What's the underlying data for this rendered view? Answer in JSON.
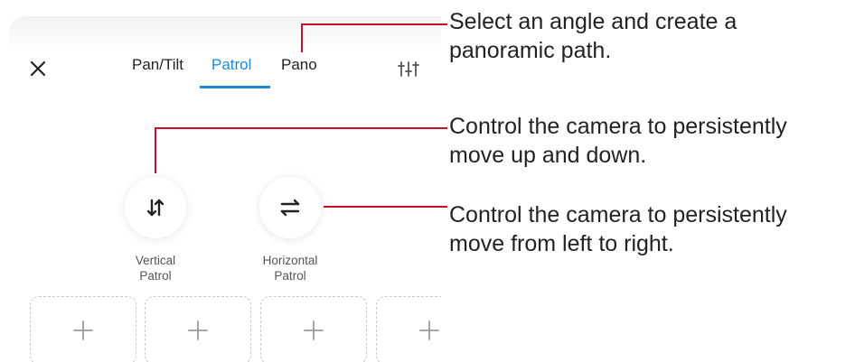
{
  "toolbar": {
    "close_icon": "close-icon",
    "settings_icon": "sliders-icon"
  },
  "tabs": [
    {
      "label": "Pan/Tilt",
      "active": false
    },
    {
      "label": "Patrol",
      "active": true
    },
    {
      "label": "Pano",
      "active": false
    }
  ],
  "patrol": {
    "vertical": {
      "line1": "Vertical",
      "line2": "Patrol",
      "icon": "vertical-arrows-icon"
    },
    "horizontal": {
      "line1": "Horizontal",
      "line2": "Patrol",
      "icon": "horizontal-arrows-icon"
    }
  },
  "presets": [
    {
      "icon": "plus-icon"
    },
    {
      "icon": "plus-icon"
    },
    {
      "icon": "plus-icon"
    },
    {
      "icon": "plus-icon"
    }
  ],
  "callouts": {
    "pano": {
      "line1": "Select an angle and create a",
      "line2": "panoramic path."
    },
    "vertical": {
      "line1": "Control the camera to persistently",
      "line2": "move up and down."
    },
    "horizontal": {
      "line1": "Control the camera to persistently",
      "line2": "move from left to right."
    }
  },
  "colors": {
    "accent": "#1e88d6",
    "callout_line": "#c8102e",
    "text": "#222222"
  }
}
